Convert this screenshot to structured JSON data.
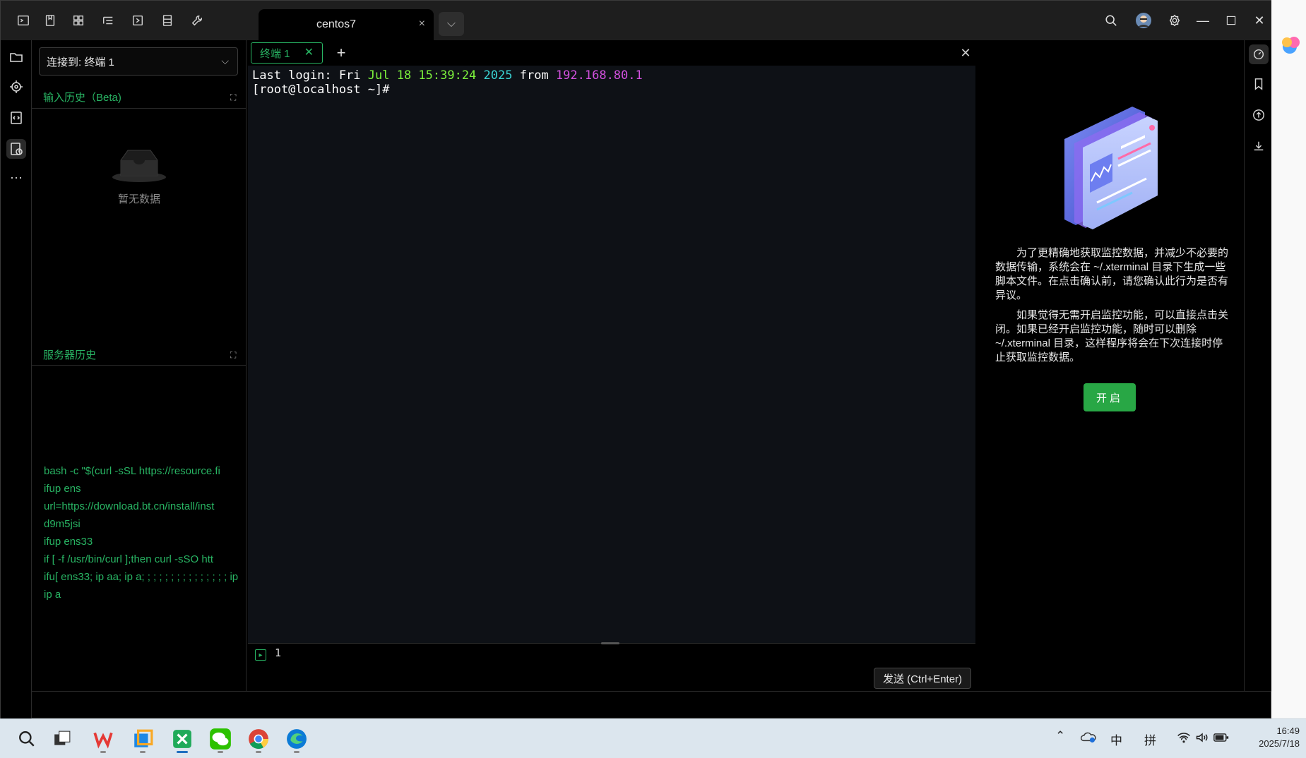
{
  "window": {
    "session_tab_title": "centos7",
    "session_tab_close": "×"
  },
  "sidepanel": {
    "connect_label": "连接到: 终端 1",
    "input_history_title": "输入历史（Beta)",
    "empty_text": "暂无数据",
    "server_history_title": "服务器历史",
    "server_history": [
      "bash -c \"$(curl -sSL https://resource.fi",
      "ifup ens",
      "url=https://download.bt.cn/install/inst",
      "d9m5jsi",
      "ifup ens33",
      "if [ -f /usr/bin/curl ];then curl -sSO htt",
      "ifu[ ens33; ip aa; ip a; ; ; ; ; ; ; ; ; ; ; ; ; ; ; ip",
      "ip a"
    ]
  },
  "terminal": {
    "tab_label": "终端  1",
    "line1": {
      "p1": "Last login: Fri ",
      "p2": "Jul 18 15:39:24",
      "p3": " ",
      "p4": "2025",
      "p5": " from ",
      "p6": "192.168.80.1"
    },
    "prompt": "[root@localhost ~]#",
    "input_line_number": "1",
    "send_label": "发送 (Ctrl+Enter)"
  },
  "monitor": {
    "para1": "为了更精确地获取监控数据，并减少不必要的数据传输，系统会在 ~/.xterminal 目录下生成一些脚本文件。在点击确认前，请您确认此行为是否有异议。",
    "para2": "如果觉得无需开启监控功能，可以直接点击关闭。如果已经开启监控功能，随时可以删除 ~/.xterminal 目录，这样程序将会在下次连接时停止获取监控数据。",
    "enable_label": "开启"
  },
  "taskbar": {
    "ime_lang": "中",
    "ime_mode": "拼",
    "time": "16:49",
    "date": "2025/7/18"
  },
  "colors": {
    "accent_green": "#28b463",
    "terminal_bg": "#0e1116",
    "button_green": "#28a745"
  }
}
